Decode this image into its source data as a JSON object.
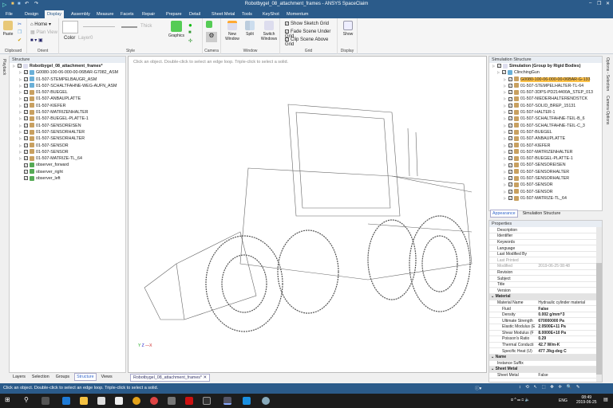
{
  "title": "Robotbygel_08_attachment_frames - ANSYS SpaceClaim",
  "tabs": [
    "File",
    "Design",
    "Display",
    "Assembly",
    "Measure",
    "Facets",
    "Repair",
    "Prepare",
    "Detail",
    "Sheet Metal",
    "Tools",
    "KeyShot",
    "Momentum"
  ],
  "active_tab": "Display",
  "ribbon": {
    "clipboard": {
      "label": "Clipboard",
      "paste": "Paste"
    },
    "orient": {
      "label": "Orient",
      "home": "Home",
      "plan_view": "Plan View"
    },
    "style": {
      "label": "Style",
      "color": "Color",
      "layer": "Layer0",
      "thick": "Thick",
      "graphics": "Graphics"
    },
    "camera": {
      "label": "Camera"
    },
    "window": {
      "label": "Window",
      "new_window": "New Window",
      "split": "Split",
      "switch_windows": "Switch Windows"
    },
    "grid": {
      "label": "Grid",
      "show_sketch_grid": "Show Sketch Grid",
      "fade_scene": "Fade Scene Under Grid",
      "clip_scene": "Clip Scene Above Grid"
    },
    "display": {
      "label": "Display",
      "show": "Show"
    }
  },
  "left": {
    "vtab": "Playback",
    "header": "Structure",
    "root": "Robotbygel_08_attachment_frames*",
    "items": [
      {
        "label": "G0080-100-06-000-00-06BAR-G7082_ASM",
        "icon": "assembly"
      },
      {
        "label": "01-507-STEMPELBAUGR_ASM",
        "icon": "assembly"
      },
      {
        "label": "01-507-SCHALTFAHNE-WEG-AUFN_ASM",
        "icon": "assembly"
      },
      {
        "label": "01-507-BUEGEL",
        "icon": "part"
      },
      {
        "label": "01-507-ANBAUPLATTE",
        "icon": "part"
      },
      {
        "label": "01-507-KIEFER",
        "icon": "part"
      },
      {
        "label": "01-507-MATRIZENHALTER",
        "icon": "part"
      },
      {
        "label": "01-507-BUEGEL-PLATTE-1",
        "icon": "part"
      },
      {
        "label": "01-507-SENSOREISEN",
        "icon": "part"
      },
      {
        "label": "01-507-SENSORHALTER",
        "icon": "part"
      },
      {
        "label": "01-507-SENSORHALTER",
        "icon": "part"
      },
      {
        "label": "01-507-SENSOR",
        "icon": "part"
      },
      {
        "label": "01-507-SENSOR",
        "icon": "part"
      },
      {
        "label": "01-507-MATRIZE-TL_64",
        "icon": "part"
      },
      {
        "label": "observer_forward",
        "icon": "observer"
      },
      {
        "label": "observer_right",
        "icon": "observer"
      },
      {
        "label": "observer_left",
        "icon": "observer"
      }
    ],
    "bottom_tabs": [
      "Layers",
      "Selection",
      "Groups",
      "Structure",
      "Views"
    ],
    "active_bottom": "Structure"
  },
  "viewport": {
    "hint": "Click an object. Double-click to select an edge loop. Triple-click to select a solid.",
    "doc_tab": "Robotbygel_08_attachment_frames*",
    "axes": [
      "Y",
      "Z",
      "X"
    ]
  },
  "sim": {
    "header": "Simulation Structure",
    "root": "Simulation (Group by Rigid Bodies)",
    "group": "ClinchingGun",
    "items": [
      "G0080-100-06-000-00-06BAR-G-133",
      "01-507-STEMPELHALTER-TL-64",
      "01-507-3DPS-PD214400A_STEP_013",
      "01-507-NIEDERHALTERENDSTCK",
      "01-507-SOLID_BREP_15131",
      "01-507-HALTER-1",
      "01-507-SCHALTFAHNE-TEIL-B_6",
      "01-507-SCHALTFAHNE-TEIL-C_3",
      "01-507-BUEGEL",
      "01-507-ANBAUPLATTE",
      "01-507-KIEFER",
      "01-507-MATRIZENHALTER",
      "01-507-BUEGEL-PLATTE-1",
      "01-507-SENSOREISEN",
      "01-507-SENSORHALTER",
      "01-507-SENSORHALTER",
      "01-507-SENSOR",
      "01-507-SENSOR",
      "01-507-MATRIZE-TL_64"
    ],
    "selected_index": 0,
    "tabs": [
      "Appearance",
      "Simulation Structure"
    ]
  },
  "right_vtabs": [
    "Options - Selection",
    "Camera Options"
  ],
  "props": {
    "header": "Properties",
    "rows": [
      {
        "k": "Description",
        "v": ""
      },
      {
        "k": "Identifier",
        "v": ""
      },
      {
        "k": "Keywords",
        "v": ""
      },
      {
        "k": "Language",
        "v": ""
      },
      {
        "k": "Last Modified By",
        "v": ""
      },
      {
        "k": "Last Printed",
        "v": "",
        "dim": true
      },
      {
        "k": "Modified",
        "v": "2019-06-25 08:48",
        "dim": true
      },
      {
        "k": "Revision",
        "v": ""
      },
      {
        "k": "Subject",
        "v": ""
      },
      {
        "k": "Title",
        "v": ""
      },
      {
        "k": "Version",
        "v": ""
      },
      {
        "cat": "Material"
      },
      {
        "k": "Material Name",
        "v": "Hydraulic cylinder material"
      },
      {
        "k": "Fluid",
        "v": "False",
        "b": true,
        "sub": true
      },
      {
        "k": "Density",
        "v": "0.002 g/mm^3",
        "b": true,
        "sub": true
      },
      {
        "k": "Ultimate Strength",
        "v": "670000000 Pa",
        "b": true,
        "sub": true
      },
      {
        "k": "Elastic Modulus (E",
        "v": "2.0500E+11 Pa",
        "b": true,
        "sub": true
      },
      {
        "k": "Shear Modulus (F",
        "v": "8.0000E+10 Pa",
        "b": true,
        "sub": true
      },
      {
        "k": "Poisson's Ratio",
        "v": "0.29",
        "b": true,
        "sub": true
      },
      {
        "k": "Thermal Conducti",
        "v": "42.7 W/m-K",
        "b": true,
        "sub": true
      },
      {
        "k": "Specific Heat (U)",
        "v": "477 J/kg-deg C",
        "b": true,
        "sub": true
      },
      {
        "cat": "Name"
      },
      {
        "k": "Instance Suffix",
        "v": ""
      },
      {
        "cat": "Sheet Metal"
      },
      {
        "k": "Sheet Metal",
        "v": "False"
      }
    ]
  },
  "status": {
    "text": "Click an object. Double-click to select an edge loop. Triple-click to select a solid."
  },
  "taskbar": {
    "lang": "ENG",
    "time": "08:49",
    "date": "2019-06-25"
  },
  "colors": {
    "accent": "#2b5b8a",
    "selection": "#ffc24a"
  }
}
